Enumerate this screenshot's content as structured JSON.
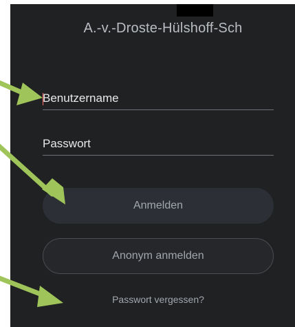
{
  "app": {
    "title": "A.-v.-Droste-Hülshoff-Sch"
  },
  "form": {
    "username_placeholder": "Benutzername",
    "password_placeholder": "Passwort",
    "login_label": "Anmelden",
    "anonymous_login_label": "Anonym anmelden",
    "forgot_password_label": "Passwort vergessen?"
  },
  "colors": {
    "background": "#202123",
    "annotation_arrow": "#9fc55a",
    "caret": "#ff6a6a"
  }
}
